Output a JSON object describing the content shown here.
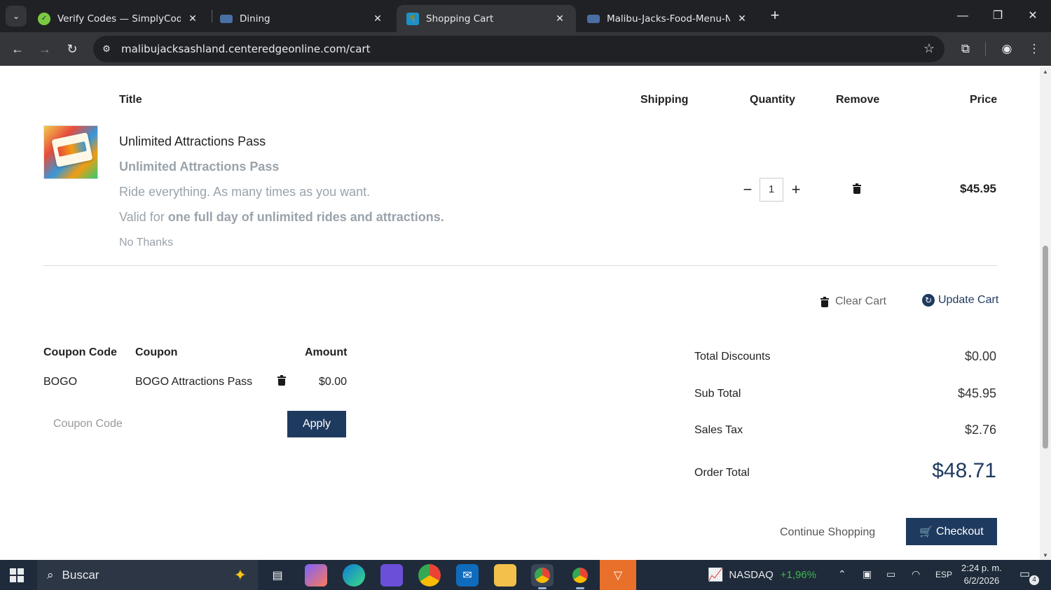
{
  "browser": {
    "tabs": [
      {
        "title": "Verify Codes — SimplyCodes",
        "favicon": "check-circle-icon",
        "active": false
      },
      {
        "title": "Dining",
        "favicon": "site-logo-icon",
        "active": false
      },
      {
        "title": "Shopping Cart",
        "favicon": "palm-tree-icon",
        "active": true
      },
      {
        "title": "Malibu-Jacks-Food-Menu-No-F",
        "favicon": "site-logo-icon",
        "active": false
      }
    ],
    "url": "malibujacksashland.centeredgeonline.com/cart"
  },
  "cart": {
    "headers": {
      "title": "Title",
      "shipping": "Shipping",
      "quantity": "Quantity",
      "remove": "Remove",
      "price": "Price"
    },
    "item": {
      "name": "Unlimited Attractions Pass",
      "subtitle": "Unlimited Attractions Pass",
      "desc1": "Ride everything. As many times as you want.",
      "desc2_prefix": "Valid for ",
      "desc2_bold": "one full day of unlimited rides and attractions.",
      "no_thanks": "No Thanks",
      "quantity": "1",
      "minus": "−",
      "plus": "+",
      "price": "$45.95"
    },
    "actions": {
      "clear": "Clear Cart",
      "update": "Update Cart"
    }
  },
  "coupons": {
    "headers": {
      "code": "Coupon Code",
      "coupon": "Coupon",
      "amount": "Amount"
    },
    "rows": [
      {
        "code": "BOGO",
        "coupon": "BOGO Attractions Pass",
        "amount": "$0.00"
      }
    ],
    "input_placeholder": "Coupon Code",
    "apply": "Apply"
  },
  "summary": {
    "total_discounts_label": "Total Discounts",
    "total_discounts": "$0.00",
    "subtotal_label": "Sub Total",
    "subtotal": "$45.95",
    "tax_label": "Sales Tax",
    "tax": "$2.76",
    "order_total_label": "Order Total",
    "order_total": "$48.71"
  },
  "footer": {
    "continue": "Continue Shopping",
    "checkout": "Checkout"
  },
  "taskbar": {
    "search": "Buscar",
    "ticker": "NASDAQ",
    "ticker_change": "+1,96%",
    "lang": "ESP",
    "time": "2:24 p. m.",
    "date": "6/2/2026",
    "notifications": "4"
  }
}
